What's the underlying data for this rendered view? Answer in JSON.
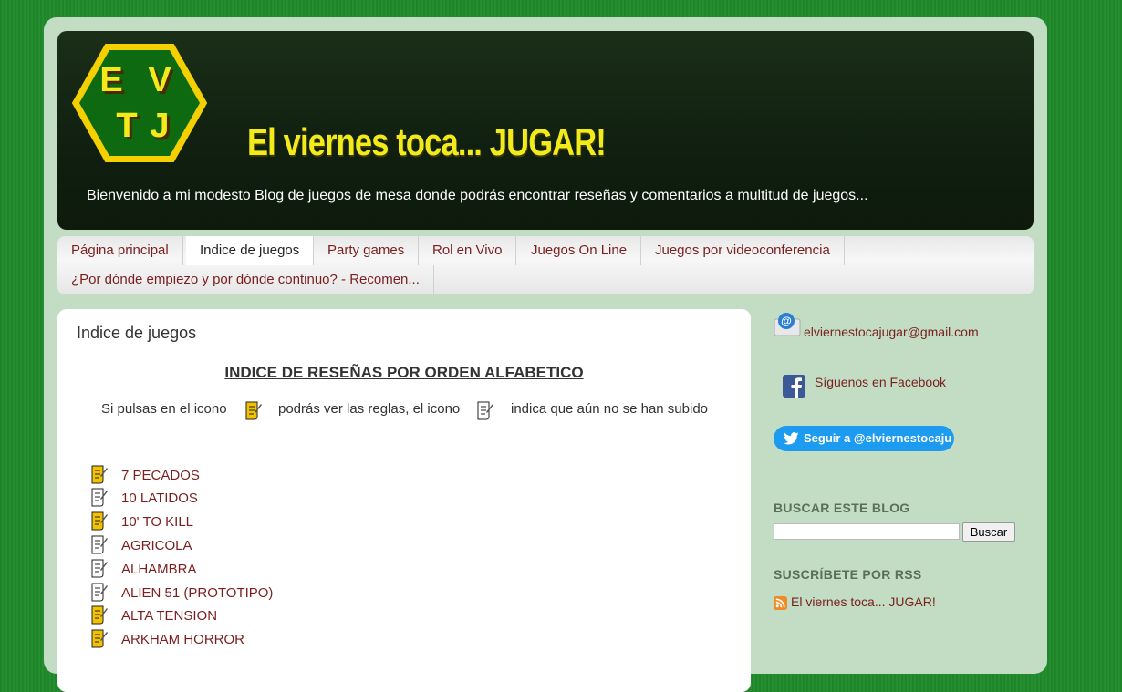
{
  "header": {
    "logo_letters": [
      "E",
      "V",
      "T",
      "J"
    ],
    "title": "El viernes toca... JUGAR!",
    "description": "Bienvenido a mi modesto Blog de juegos de mesa donde podrás encontrar reseñas y comentarios a multitud de juegos..."
  },
  "tabs": [
    {
      "label": "Página principal",
      "active": false
    },
    {
      "label": "Indice de juegos",
      "active": true
    },
    {
      "label": "Party games",
      "active": false
    },
    {
      "label": "Rol en Vivo",
      "active": false
    },
    {
      "label": "Juegos On Line",
      "active": false
    },
    {
      "label": "Juegos por videoconferencia",
      "active": false
    },
    {
      "label": "¿Por dónde empiezo y por dónde continuo? - Recomen...",
      "active": false
    }
  ],
  "main": {
    "page_title": "Indice de juegos",
    "heading": "INDICE DE RESEÑAS POR ORDEN ALFABETICO",
    "legend": {
      "part1": "Si pulsas en el icono",
      "part2": "podrás ver las reglas, el icono",
      "part3": "indica que aún no se han subido",
      "icon_with_rules": "rules-icon",
      "icon_without_rules": "no-rules-icon"
    },
    "games": [
      {
        "name": "7 PECADOS",
        "has_rules": true
      },
      {
        "name": "10 LATIDOS",
        "has_rules": false
      },
      {
        "name": "10' TO KILL",
        "has_rules": true
      },
      {
        "name": "AGRICOLA",
        "has_rules": false
      },
      {
        "name": "ALHAMBRA",
        "has_rules": false
      },
      {
        "name": "ALIEN 51 (PROTOTIPO)",
        "has_rules": false
      },
      {
        "name": "ALTA TENSION",
        "has_rules": true
      },
      {
        "name": "ARKHAM HORROR",
        "has_rules": true
      }
    ]
  },
  "sidebar": {
    "email": "elviernestocajugar@gmail.com",
    "facebook_label": "Síguenos en Facebook",
    "twitter_label": "Seguir a @elviernestocaju",
    "search_title": "BUSCAR ESTE BLOG",
    "search_button": "Buscar",
    "search_value": "",
    "rss_title": "SUSCRÍBETE POR RSS",
    "rss_link": "El viernes toca... JUGAR!"
  },
  "colors": {
    "background": "#1f8a2a",
    "link": "#7a1f1f",
    "title_yellow": "#f3ea1c",
    "twitter_blue": "#1d9bf0",
    "facebook_blue": "#3b5998"
  }
}
